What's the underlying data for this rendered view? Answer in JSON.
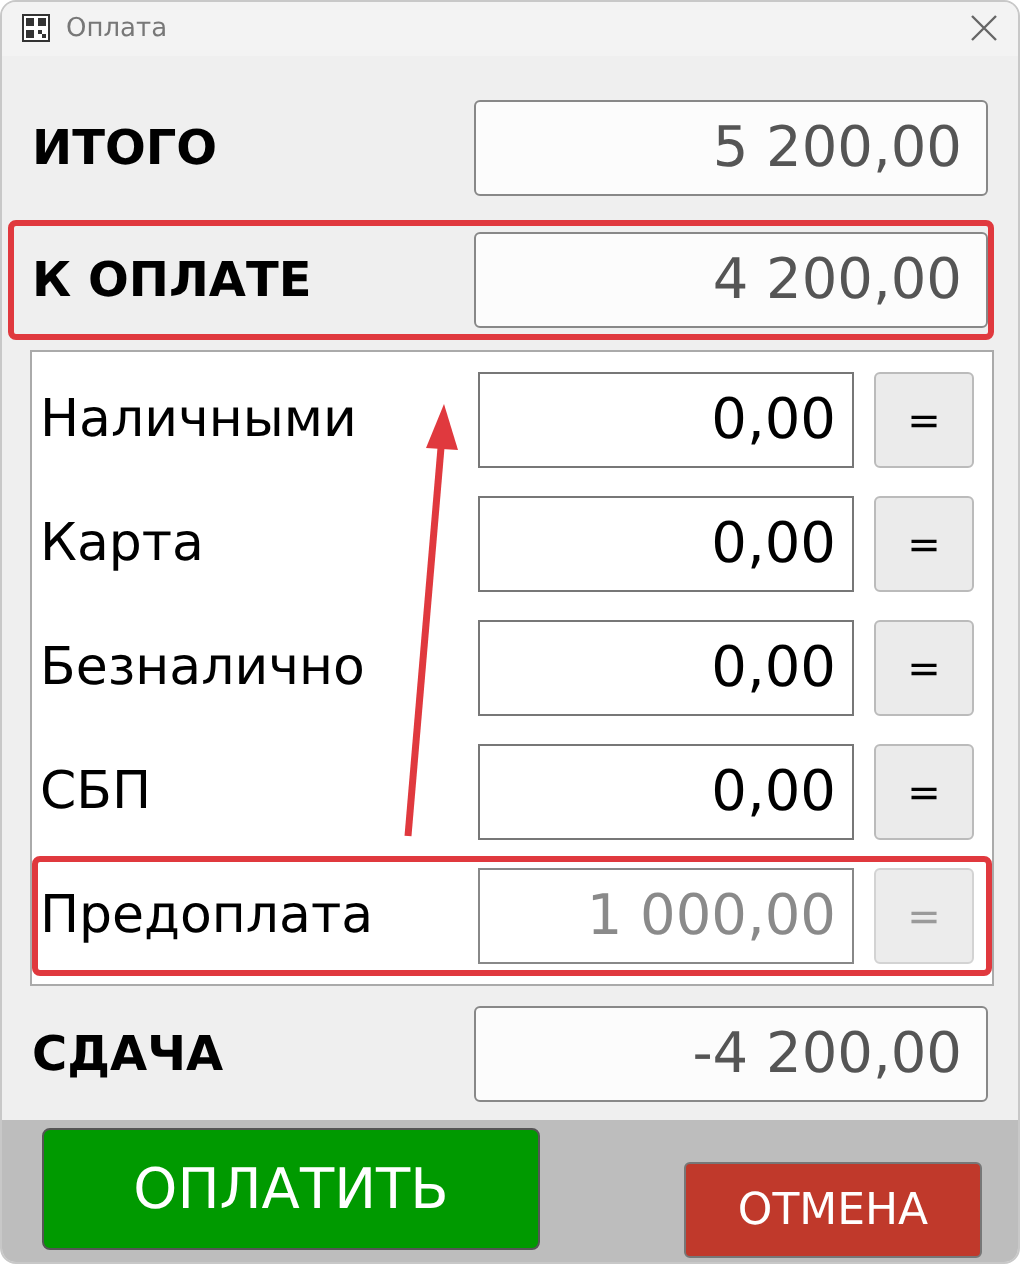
{
  "window": {
    "title": "Оплата"
  },
  "totals": [
    {
      "label": "ИТОГО",
      "value": "5 200,00",
      "highlighted": false
    },
    {
      "label": "К ОПЛАТЕ",
      "value": "4 200,00",
      "highlighted": true
    }
  ],
  "payments": [
    {
      "label": "Наличными",
      "value": "0,00",
      "button": "=",
      "disabled": false,
      "highlighted": false
    },
    {
      "label": "Карта",
      "value": "0,00",
      "button": "=",
      "disabled": false,
      "highlighted": false
    },
    {
      "label": "Безналично",
      "value": "0,00",
      "button": "=",
      "disabled": false,
      "highlighted": false
    },
    {
      "label": "СБП",
      "value": "0,00",
      "button": "=",
      "disabled": false,
      "highlighted": false
    },
    {
      "label": "Предоплата",
      "value": "1 000,00",
      "button": "=",
      "disabled": true,
      "highlighted": true
    }
  ],
  "annotation_arrow": true,
  "change": {
    "label": "СДАЧА",
    "value": "-4 200,00"
  },
  "buttons": [
    {
      "kind": "pay",
      "label": "ОПЛАТИТЬ"
    },
    {
      "kind": "cancel",
      "label": "ОТМЕНА"
    }
  ]
}
